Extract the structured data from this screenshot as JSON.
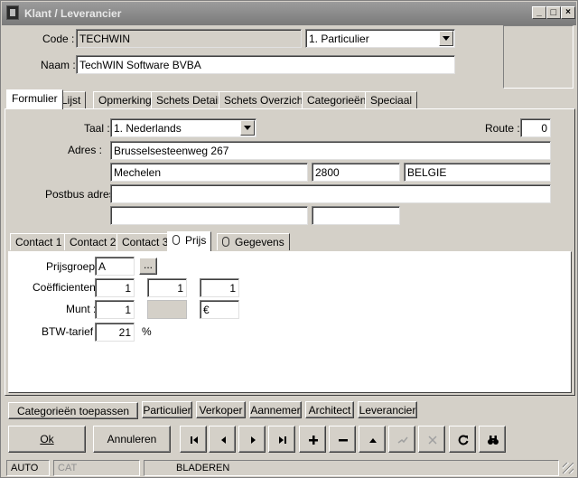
{
  "window": {
    "title": "Klant / Leverancier",
    "min": "_",
    "max": "□",
    "close": "×"
  },
  "header": {
    "code_label": "Code :",
    "code_value": "TECHWIN",
    "type_value": "1.  Particulier",
    "naam_label": "Naam :",
    "naam_value": "TechWIN Software BVBA"
  },
  "main_tabs": [
    "Formulier",
    "Lijst",
    "Opmerking",
    "Schets Detail",
    "Schets Overzicht",
    "Categorieën",
    "Speciaal"
  ],
  "form": {
    "taal_label": "Taal :",
    "taal_value": "1.  Nederlands",
    "route_label": "Route :",
    "route_value": "0",
    "adres_label": "Adres :",
    "adres_street": "Brusselsesteenweg 267",
    "adres_city": "Mechelen",
    "adres_zip": "2800",
    "adres_country": "BELGIE",
    "postbus_label": "Postbus adres :",
    "postbus_value": ""
  },
  "sub_tabs": [
    "Contact 1",
    "Contact 2",
    "Contact 3",
    "Prijs",
    "Gegevens"
  ],
  "prijs": {
    "prijsgroep_label": "Prijsgroep :",
    "prijsgroep_value": "A",
    "ellipsis": "...",
    "coef_label": "Coëfficienten :",
    "coef_values": [
      "1",
      "1",
      "1"
    ],
    "munt_label": "Munt :",
    "munt_value": "1",
    "munt_symbol": "€",
    "btw_label": "BTW-tarief :",
    "btw_value": "21",
    "btw_unit": "%"
  },
  "category_buttons": {
    "apply": "Categorieën toepassen",
    "items": [
      "Particulier",
      "Verkoper",
      "Aannemer",
      "Architect",
      "Leverancier"
    ]
  },
  "actions": {
    "ok": "Ok",
    "cancel": "Annuleren"
  },
  "nav_icons": [
    "first-record-icon",
    "previous-record-icon",
    "next-record-icon",
    "last-record-icon",
    "add-record-icon",
    "delete-record-icon",
    "move-up-icon",
    "confirm-icon",
    "cancel-edit-icon",
    "refresh-icon",
    "search-binoculars-icon"
  ],
  "statusbar": {
    "auto": "AUTO",
    "cat": "CAT",
    "mode": "BLADEREN"
  }
}
